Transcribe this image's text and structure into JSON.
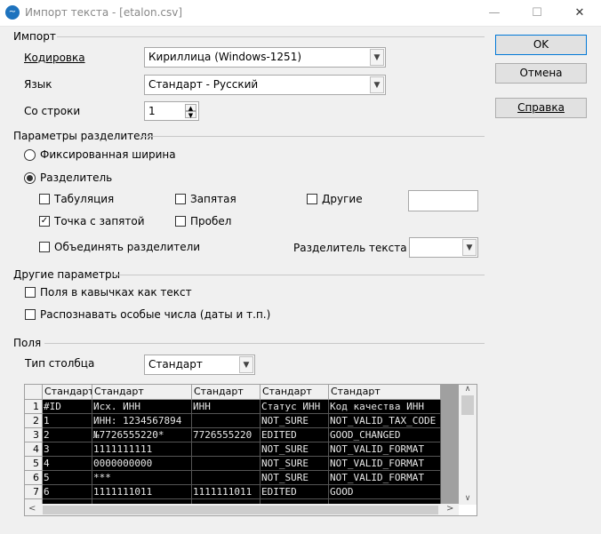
{
  "window": {
    "title": "Импорт текста - [etalon.csv]",
    "minimize": "—",
    "maximize": "☐",
    "close": "✕"
  },
  "import": {
    "section": "Импорт",
    "encoding_label": "Кодировка",
    "encoding_value": "Кириллица (Windows-1251)",
    "language_label": "Язык",
    "language_value": "Стандарт - Русский",
    "from_row_label": "Со строки",
    "from_row_value": "1"
  },
  "buttons": {
    "ok": "OK",
    "cancel": "Отмена",
    "help": "Справка"
  },
  "separator": {
    "section": "Параметры разделителя",
    "fixed_width": "Фиксированная ширина",
    "separated": "Разделитель",
    "separated_selected": true,
    "tab": "Табуляция",
    "tab_checked": false,
    "comma": "Запятая",
    "comma_checked": false,
    "other": "Другие",
    "other_checked": false,
    "other_value": "",
    "semicolon": "Точка с запятой",
    "semicolon_checked": true,
    "space": "Пробел",
    "space_checked": false,
    "merge": "Объединять разделители",
    "merge_checked": false,
    "text_delimiter_label": "Разделитель текста",
    "text_delimiter_value": ""
  },
  "other_options": {
    "section": "Другие параметры",
    "quoted_as_text": "Поля в кавычках как текст",
    "quoted_checked": false,
    "detect_special": "Распознавать особые числа (даты и т.п.)",
    "detect_checked": false
  },
  "fields": {
    "section": "Поля",
    "column_type_label": "Тип столбца",
    "column_type_value": "Стандарт",
    "headers": [
      "Стандарт",
      "Стандарт",
      "Стандарт",
      "Стандарт",
      "Стандарт"
    ],
    "rows": [
      [
        "1",
        "#ID",
        "Исх. ИНН",
        "ИНН",
        "Статус ИНН",
        "Код качества ИНН"
      ],
      [
        "2",
        "1",
        "ИНН: 1234567894",
        "",
        "NOT_SURE",
        "NOT_VALID_TAX_CODE"
      ],
      [
        "3",
        "2",
        "№7726555220*",
        "7726555220",
        "EDITED",
        "GOOD_CHANGED"
      ],
      [
        "4",
        "3",
        "1111111111",
        "",
        "NOT_SURE",
        "NOT_VALID_FORMAT"
      ],
      [
        "5",
        "4",
        "0000000000",
        "",
        "NOT_SURE",
        "NOT_VALID_FORMAT"
      ],
      [
        "6",
        "5",
        "***",
        "",
        "NOT_SURE",
        "NOT_VALID_FORMAT"
      ],
      [
        "7",
        "6",
        "1111111011",
        "1111111011",
        "EDITED",
        "GOOD"
      ]
    ]
  }
}
